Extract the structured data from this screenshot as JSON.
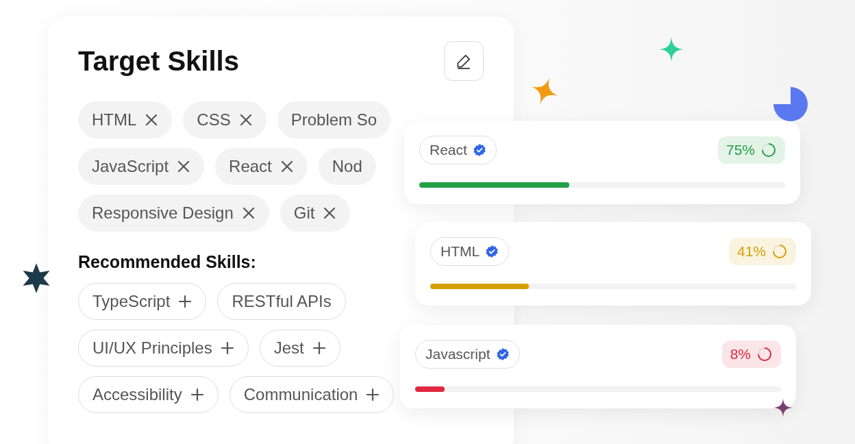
{
  "title": "Target Skills",
  "target_skill_rows": [
    [
      {
        "label": "HTML",
        "removable": true
      },
      {
        "label": "CSS",
        "removable": true
      },
      {
        "label": "Problem So",
        "removable": false
      }
    ],
    [
      {
        "label": "JavaScript",
        "removable": true
      },
      {
        "label": "React",
        "removable": true
      },
      {
        "label": "Nod",
        "removable": false
      }
    ],
    [
      {
        "label": "Responsive Design",
        "removable": true
      },
      {
        "label": "Git",
        "removable": true
      }
    ]
  ],
  "recommended_title": "Recommended Skills:",
  "recommended_skill_rows": [
    [
      {
        "label": "TypeScript",
        "addable": true
      },
      {
        "label": "RESTful APIs",
        "addable": false
      }
    ],
    [
      {
        "label": "UI/UX Principles",
        "addable": true
      },
      {
        "label": "Jest",
        "addable": true
      }
    ],
    [
      {
        "label": "Accessibility",
        "addable": true
      },
      {
        "label": "Communication",
        "addable": true
      }
    ]
  ],
  "progress_cards": [
    {
      "skill": "React",
      "verified": true,
      "reading": "75%",
      "color": "#22a045",
      "bar": {
        "level": 0.41
      }
    },
    {
      "skill": "HTML",
      "verified": true,
      "reading": "41%",
      "color": "#d6a000",
      "bar": {
        "level": 0.27
      }
    },
    {
      "skill": "Javascript",
      "verified": true,
      "reading": "8%",
      "color": "#e0293f",
      "bar": {
        "level": 0.08
      }
    }
  ]
}
